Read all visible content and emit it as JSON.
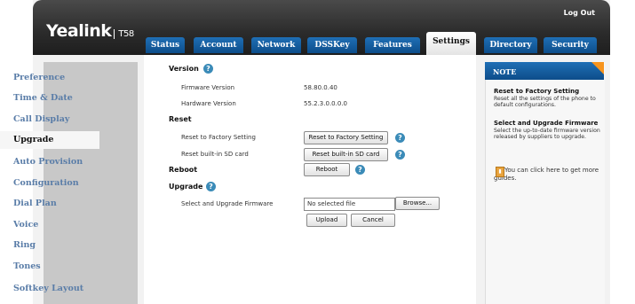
{
  "header": {
    "brand": "Yealink",
    "model": "T58",
    "logout": "Log Out"
  },
  "tabs": [
    {
      "label": "Status"
    },
    {
      "label": "Account"
    },
    {
      "label": "Network"
    },
    {
      "label": "DSSKey"
    },
    {
      "label": "Features"
    },
    {
      "label": "Settings"
    },
    {
      "label": "Directory"
    },
    {
      "label": "Security"
    }
  ],
  "active_tab": "Settings",
  "sidebar": {
    "items": [
      {
        "label": "Preference"
      },
      {
        "label": "Time & Date"
      },
      {
        "label": "Call Display"
      },
      {
        "label": "Upgrade"
      },
      {
        "label": "Auto Provision"
      },
      {
        "label": "Configuration"
      },
      {
        "label": "Dial Plan"
      },
      {
        "label": "Voice"
      },
      {
        "label": "Ring"
      },
      {
        "label": "Tones"
      },
      {
        "label": "Softkey Layout"
      }
    ],
    "active": "Upgrade"
  },
  "main": {
    "version": {
      "heading": "Version",
      "firmware_label": "Firmware Version",
      "firmware_value": "58.80.0.40",
      "hardware_label": "Hardware Version",
      "hardware_value": "55.2.3.0.0.0.0"
    },
    "reset": {
      "heading": "Reset",
      "factory_label": "Reset to Factory Setting",
      "factory_button": "Reset to Factory Setting",
      "sd_label": "Reset built-in SD card",
      "sd_button": "Reset built-in SD card"
    },
    "reboot": {
      "heading": "Reboot",
      "button": "Reboot"
    },
    "upgrade": {
      "heading": "Upgrade",
      "select_label": "Select and Upgrade Firmware",
      "file_value": "No selected file",
      "browse_button": "Browse...",
      "upload_button": "Upload",
      "cancel_button": "Cancel"
    }
  },
  "note": {
    "heading": "NOTE",
    "reset_title": "Reset to Factory Setting",
    "reset_text": "Reset all the settings of the phone to default configurations.",
    "upgrade_title": "Select and Upgrade Firmware",
    "upgrade_text": "Select the up-to-date firmware version released by suppliers to upgrade.",
    "guide_text": "You can click here to get more guides."
  },
  "colors": {
    "tab_blue": "#1f6fb5",
    "header_dark": "#2b2b2b",
    "sidebar_bg": "#c8c8c8",
    "sidebar_text": "#5a7da8",
    "note_corner": "#f7941d",
    "help_icon": "#3b8bb8"
  }
}
